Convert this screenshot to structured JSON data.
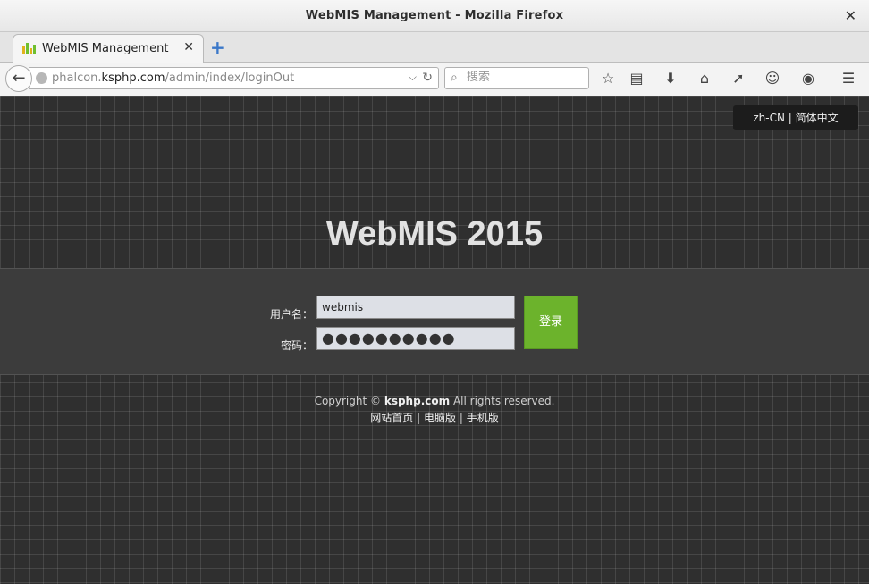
{
  "window": {
    "title": "WebMIS Management - Mozilla Firefox"
  },
  "tabs": [
    {
      "label": "WebMIS Management"
    }
  ],
  "navbar": {
    "url_host": "phalcon.",
    "url_domain": "ksphp.com",
    "url_path": "/admin/index/loginOut",
    "search_placeholder": "搜索"
  },
  "page": {
    "language_switch": "zh-CN | 简体中文",
    "title": "WebMIS 2015",
    "form": {
      "username_label": "用户名：",
      "username_value": "webmis",
      "password_label": "密码：",
      "password_mask": "●●●●●●●●●●",
      "submit_label": "登录"
    },
    "footer": {
      "copyright_prefix": "Copyright ©",
      "copyright_site": "ksphp.com",
      "copyright_suffix": "All rights reserved.",
      "links": [
        "网站首页",
        "电脑版",
        "手机版"
      ],
      "link_separator": "|"
    }
  },
  "colors": {
    "accent_green": "#6cb32c",
    "page_bg": "#2f2f2f",
    "band_bg": "#3c3c3c"
  }
}
